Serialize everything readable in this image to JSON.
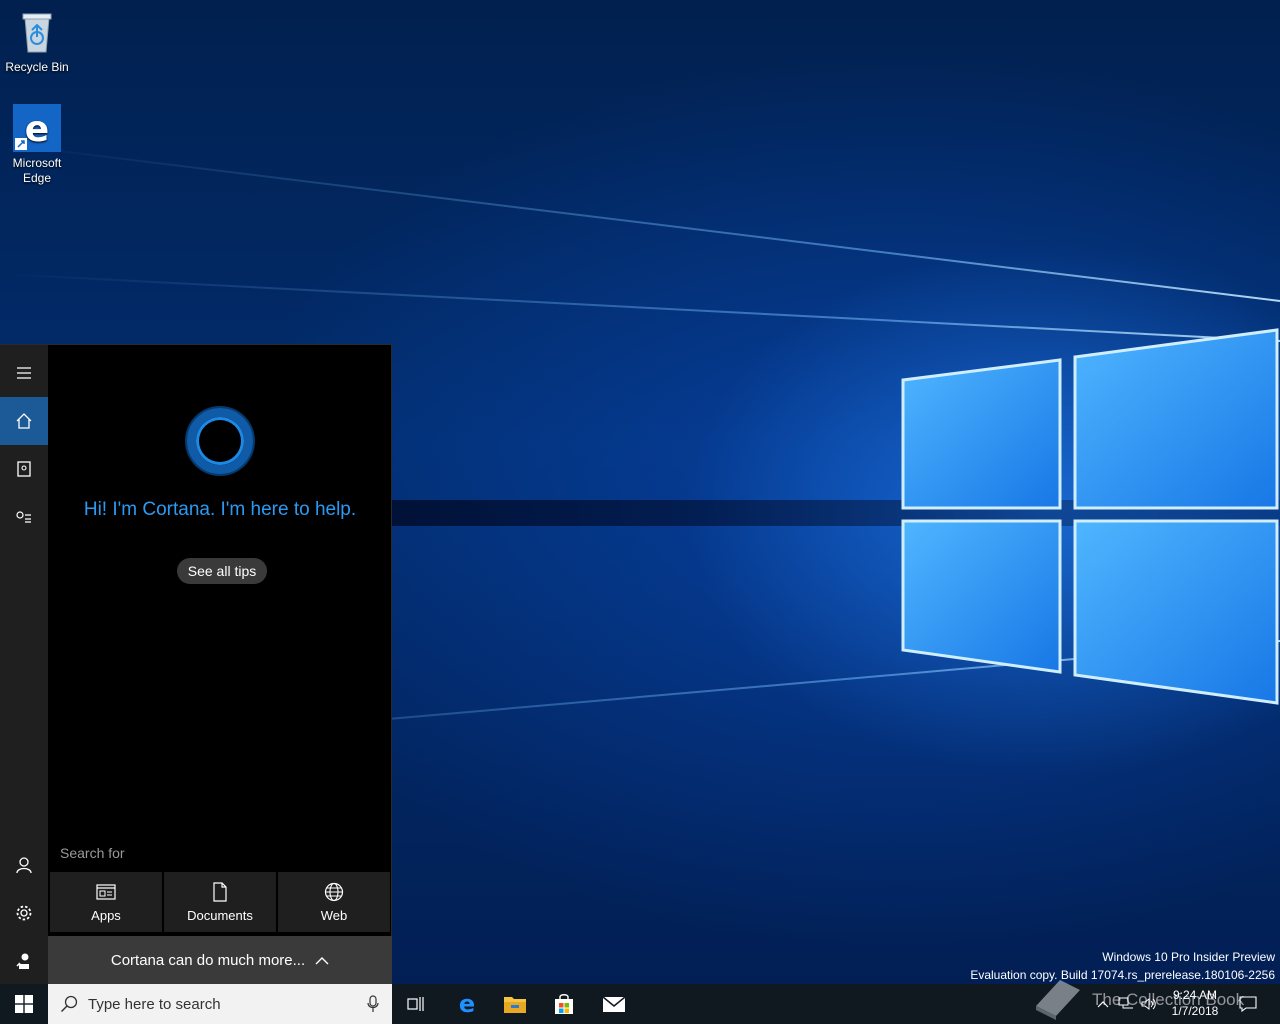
{
  "desktop": {
    "icons": [
      {
        "label": "Recycle Bin"
      },
      {
        "label_line1": "Microsoft",
        "label_line2": "Edge"
      }
    ],
    "watermark": {
      "line1": "Windows 10 Pro Insider Preview",
      "line2": "Evaluation copy. Build 17074.rs_prerelease.180106-2256"
    }
  },
  "cortana": {
    "greeting": "Hi! I'm Cortana. I'm here to help.",
    "tips_button": "See all tips",
    "search_for_label": "Search for",
    "filters": [
      {
        "label": "Apps"
      },
      {
        "label": "Documents"
      },
      {
        "label": "Web"
      }
    ],
    "more_bar": "Cortana can do much more..."
  },
  "taskbar": {
    "search_placeholder": "Type here to search",
    "clock_time": "9:24 AM",
    "clock_date": "1/7/2018",
    "overlay_text": "The Collection Book"
  },
  "colors": {
    "accent": "#1b5a96",
    "cortana_blue": "#2b9af3",
    "taskbar": "#101820"
  }
}
